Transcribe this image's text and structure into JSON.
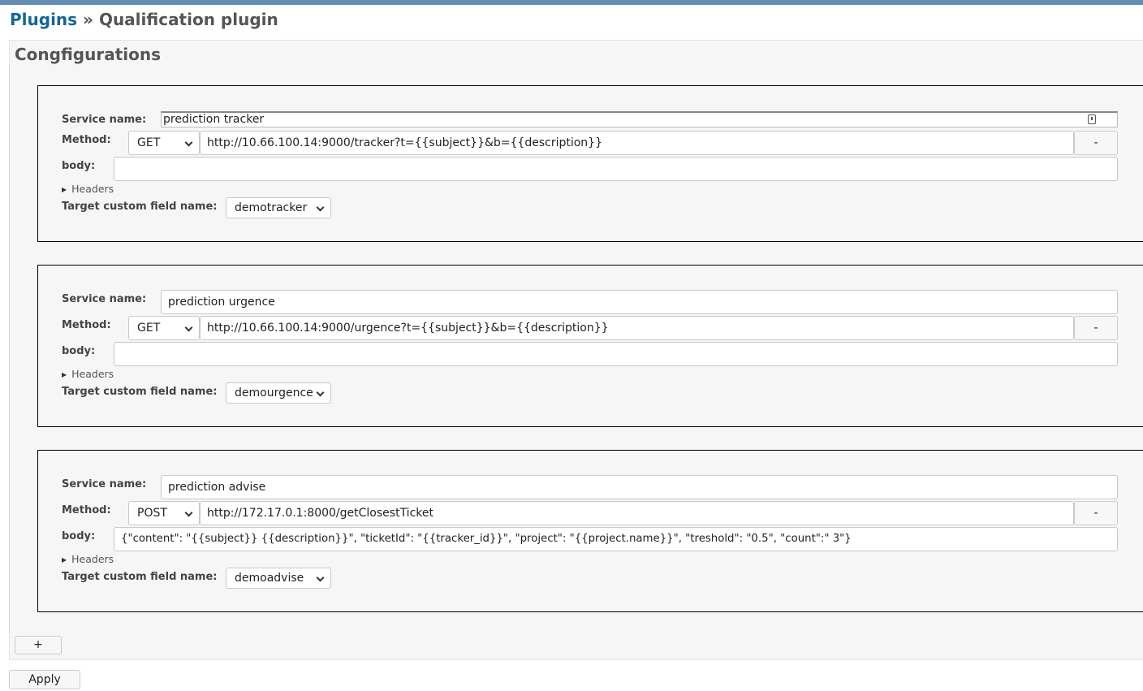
{
  "breadcrumb": {
    "root": "Plugins",
    "separator": "»",
    "current": "Qualification plugin"
  },
  "section_title": "Congfigurations",
  "labels": {
    "service_name": "Service name:",
    "method": "Method:",
    "body": "body:",
    "headers": "Headers",
    "target_field": "Target custom field name:"
  },
  "configs": [
    {
      "service_name": "prediction tracker",
      "method": "GET",
      "url": "http://10.66.100.14:9000/tracker?t={{subject}}&b={{description}}",
      "body": "",
      "target_field": "demotracker",
      "remove_label": "-"
    },
    {
      "service_name": "prediction urgence",
      "method": "GET",
      "url": "http://10.66.100.14:9000/urgence?t={{subject}}&b={{description}}",
      "body": "",
      "target_field": "demourgence",
      "remove_label": "-"
    },
    {
      "service_name": "prediction advise",
      "method": "POST",
      "url": "http://172.17.0.1:8000/getClosestTicket",
      "body": "{\"content\": \"{{subject}}  {{description}}\",   \"ticketId\": \"{{tracker_id}}\", \"project\": \"{{project.name}}\", \"treshold\": \"0.5\",   \"count\":\" 3\"}",
      "target_field": "demoadvise",
      "remove_label": "-"
    }
  ],
  "add_label": "+",
  "apply_label": "Apply",
  "colors": {
    "topbar": "#628db6",
    "link": "#116699",
    "panel_bg": "#f6f6f6"
  }
}
